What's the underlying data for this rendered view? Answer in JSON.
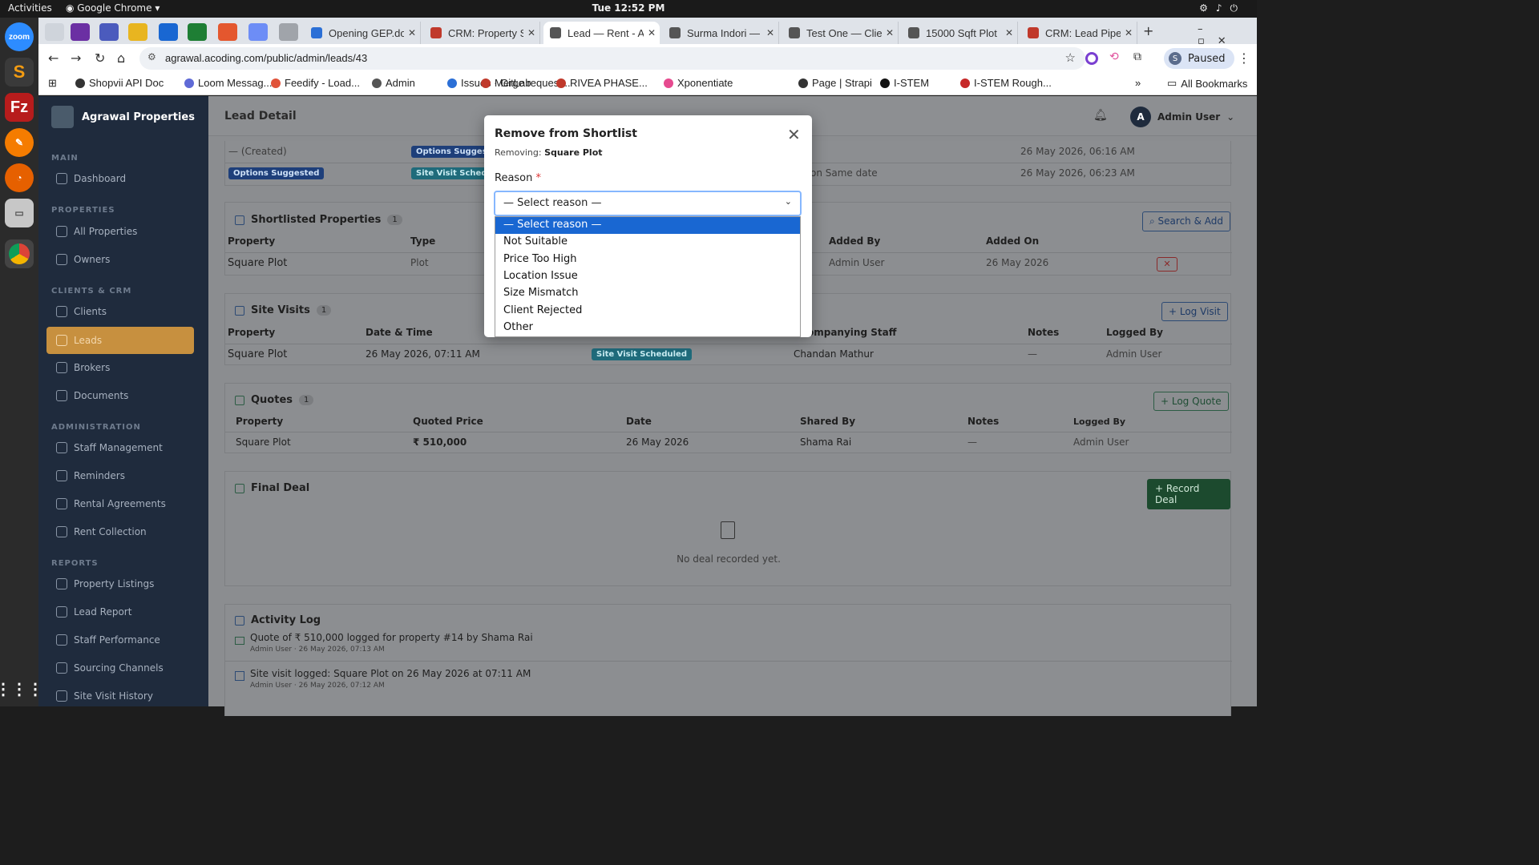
{
  "os": {
    "activities": "Activities",
    "app_name": "Google Chrome",
    "clock": "Tue 12:52 PM"
  },
  "browser": {
    "tabs": [
      {
        "title": "Opening GEP.do",
        "color": "#2b6fd6"
      },
      {
        "title": "CRM: Property S",
        "color": "#c0392b"
      },
      {
        "title": "Lead — Rent - A",
        "color": "#555555"
      },
      {
        "title": "Surma Indori —",
        "color": "#555555"
      },
      {
        "title": "Test One — Clie",
        "color": "#555555"
      },
      {
        "title": "15000 Sqft Plot",
        "color": "#555555"
      },
      {
        "title": "CRM: Lead Pipel",
        "color": "#c0392b"
      }
    ],
    "url": "agrawal.acoding.com/public/admin/leads/43",
    "profile": "Paused",
    "profile_initial": "S",
    "bookmarks": [
      "Shopvii API Doc",
      "Loom Messag...",
      "Feedify - Load...",
      "Admin",
      "Issues · GitLab",
      "Merge request...",
      "RIVEA PHASE...",
      "Xponentiate",
      "Page | Strapi",
      "I-STEM",
      "I-STEM Rough..."
    ],
    "all_bookmarks": "All Bookmarks"
  },
  "sidebar": {
    "brand": "Agrawal Properties",
    "sections": [
      {
        "title": "MAIN",
        "items": [
          "Dashboard"
        ]
      },
      {
        "title": "PROPERTIES",
        "items": [
          "All Properties",
          "Owners"
        ]
      },
      {
        "title": "CLIENTS & CRM",
        "items": [
          "Clients",
          "Leads",
          "Brokers",
          "Documents"
        ]
      },
      {
        "title": "ADMINISTRATION",
        "items": [
          "Staff Management",
          "Reminders",
          "Rental Agreements",
          "Rent Collection"
        ]
      },
      {
        "title": "REPORTS",
        "items": [
          "Property Listings",
          "Lead Report",
          "Staff Performance",
          "Sourcing Channels",
          "Site Visit History"
        ]
      }
    ],
    "active_item": "Leads"
  },
  "header": {
    "title": "Lead Detail",
    "user_initial": "A",
    "user_name": "Admin User"
  },
  "status_history": {
    "rows": [
      {
        "from": "— (Created)",
        "to": "Options Suggested",
        "note": "",
        "date": "26 May 2026, 06:16 AM"
      },
      {
        "from": "Options Suggested",
        "to": "Site Visit Schedule",
        "note": "on Same date",
        "date": "26 May 2026, 06:23 AM"
      }
    ]
  },
  "shortlisted": {
    "title": "Shortlisted Properties",
    "count": "1",
    "button": "Search & Add",
    "headers": [
      "Property",
      "Type",
      "Added By",
      "Added On"
    ],
    "rows": [
      {
        "property": "Square Plot",
        "type": "Plot",
        "added_by": "Admin User",
        "added_on": "26 May 2026"
      }
    ]
  },
  "site_visits": {
    "title": "Site Visits",
    "count": "1",
    "button": "+ Log Visit",
    "headers": [
      "Property",
      "Date & Time",
      "ompanying Staff",
      "Notes",
      "Logged By"
    ],
    "rows": [
      {
        "property": "Square Plot",
        "datetime": "26 May 2026, 07:11 AM",
        "status": "Site Visit Scheduled",
        "staff": "Chandan Mathur",
        "notes": "—",
        "logged_by": "Admin User"
      }
    ]
  },
  "quotes": {
    "title": "Quotes",
    "count": "1",
    "button": "+ Log Quote",
    "headers": [
      "Property",
      "Quoted Price",
      "Date",
      "Shared By",
      "Notes",
      "Logged By"
    ],
    "rows": [
      {
        "property": "Square Plot",
        "price": "₹ 510,000",
        "date": "26 May 2026",
        "shared_by": "Shama Rai",
        "notes": "—",
        "logged_by": "Admin User"
      }
    ]
  },
  "final_deal": {
    "title": "Final Deal",
    "button": "+ Record Deal",
    "empty": "No deal recorded yet."
  },
  "activity_log": {
    "title": "Activity Log",
    "entries": [
      {
        "text": "Quote of ₹ 510,000 logged for property #14 by Shama Rai",
        "meta": "Admin User · 26 May 2026, 07:13 AM"
      },
      {
        "text": "Site visit logged: Square Plot on 26 May 2026 at 07:11 AM",
        "meta": "Admin User · 26 May 2026, 07:12 AM"
      }
    ]
  },
  "modal": {
    "title": "Remove from Shortlist",
    "removing_label": "Removing:",
    "removing_value": "Square Plot",
    "reason_label": "Reason",
    "required_mark": "*",
    "select_value": "— Select reason —",
    "options": [
      "— Select reason —",
      "Not Suitable",
      "Price Too High",
      "Location Issue",
      "Size Mismatch",
      "Client Rejected",
      "Other"
    ],
    "highlighted_option": "— Select reason —"
  }
}
